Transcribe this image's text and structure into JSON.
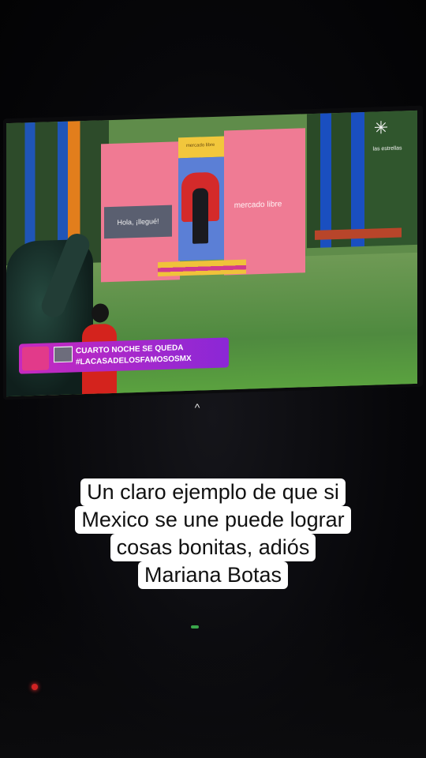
{
  "tv": {
    "sign_text": "Hola, ¡llegué!",
    "brand_text": "mercado libre",
    "brand_small_text": "mercado libre",
    "star_logo_text": "las estrellas",
    "banner": {
      "line1": "CUARTO NOCHE SE QUEDA",
      "line2": "#LACASADELOSFAMOSOSMX"
    }
  },
  "overlay": {
    "chevron": "^",
    "caption_lines": [
      "Un claro ejemplo de que si",
      "Mexico se une puede lograr",
      "cosas bonitas, adiós",
      "Mariana Botas"
    ]
  },
  "colors": {
    "banner_start": "#c62abf",
    "banner_end": "#8b27d6",
    "caption_bg": "#ffffff",
    "caption_text": "#111111"
  }
}
